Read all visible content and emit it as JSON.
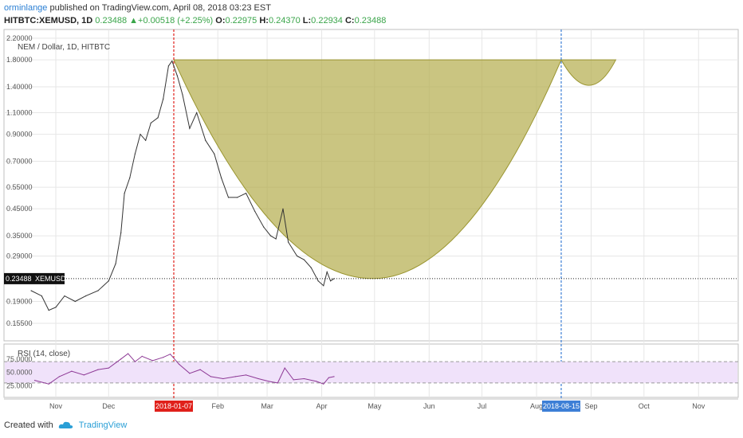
{
  "header": {
    "author": "orminlange",
    "published": "published on TradingView.com, April 08, 2018 03:23 EST",
    "symbol": "HITBTC:XEMUSD, 1D",
    "last": "0.23488",
    "change": "+0.00518 (+2.25%)",
    "o_label": "O:",
    "o": "0.22975",
    "h_label": "H:",
    "h": "0.24370",
    "l_label": "L:",
    "l": "0.22934",
    "c_label": "C:",
    "c": "0.23488"
  },
  "footer": {
    "created_with": "Created with",
    "brand": "TradingView"
  },
  "colors": {
    "price_line": "#333333",
    "cup_fill": "#b3ad4c",
    "cup_stroke": "#9a9530",
    "rsi_line": "#8e3a96",
    "rsi_band": "#f0e2fa",
    "red_marker": "#e0201a",
    "blue_marker": "#3d7fd6",
    "grid": "#e6e6e6"
  },
  "chart_data": [
    {
      "type": "line",
      "title": "NEM / Dollar, 1D, HITBTC",
      "series_name": "XEMUSD",
      "y_scale": "log",
      "y_ticks": [
        "2.20000",
        "1.80000",
        "1.40000",
        "1.10000",
        "0.90000",
        "0.70000",
        "0.55000",
        "0.45000",
        "0.35000",
        "0.29000",
        "0.19000",
        "0.15500"
      ],
      "x_ticks": [
        "Nov",
        "Dec",
        "Feb",
        "Mar",
        "Apr",
        "May",
        "Jun",
        "Jul",
        "Aug",
        "Sep",
        "Oct",
        "Nov"
      ],
      "x_date_markers": [
        "2018-01-07",
        "2018-08-15"
      ],
      "last_value": "0.23488",
      "last_label": "XEMUSD",
      "cup_points": [
        {
          "date": "2018-01-07",
          "value": 1.8
        },
        {
          "date": "2018-02-07",
          "value": 0.78
        },
        {
          "date": "2018-03-07",
          "value": 0.36
        },
        {
          "date": "2018-04-07",
          "value": 0.24
        },
        {
          "date": "2018-04-30",
          "value": 0.235
        },
        {
          "date": "2018-05-31",
          "value": 0.31
        },
        {
          "date": "2018-06-30",
          "value": 0.52
        },
        {
          "date": "2018-07-31",
          "value": 1.1
        },
        {
          "date": "2018-08-15",
          "value": 1.8
        }
      ],
      "handle_points": [
        {
          "date": "2018-08-15",
          "value": 1.8
        },
        {
          "date": "2018-08-31",
          "value": 1.42
        },
        {
          "date": "2018-09-15",
          "value": 1.8
        }
      ],
      "price_points": [
        {
          "date": "2017-10-18",
          "value": 0.21
        },
        {
          "date": "2017-10-24",
          "value": 0.2
        },
        {
          "date": "2017-10-28",
          "value": 0.175
        },
        {
          "date": "2017-11-01",
          "value": 0.18
        },
        {
          "date": "2017-11-06",
          "value": 0.2
        },
        {
          "date": "2017-11-12",
          "value": 0.19
        },
        {
          "date": "2017-11-18",
          "value": 0.2
        },
        {
          "date": "2017-11-25",
          "value": 0.21
        },
        {
          "date": "2017-12-01",
          "value": 0.23
        },
        {
          "date": "2017-12-05",
          "value": 0.27
        },
        {
          "date": "2017-12-08",
          "value": 0.36
        },
        {
          "date": "2017-12-10",
          "value": 0.52
        },
        {
          "date": "2017-12-13",
          "value": 0.6
        },
        {
          "date": "2017-12-16",
          "value": 0.75
        },
        {
          "date": "2017-12-19",
          "value": 0.9
        },
        {
          "date": "2017-12-22",
          "value": 0.85
        },
        {
          "date": "2017-12-25",
          "value": 1.0
        },
        {
          "date": "2017-12-29",
          "value": 1.05
        },
        {
          "date": "2018-01-01",
          "value": 1.25
        },
        {
          "date": "2018-01-04",
          "value": 1.7
        },
        {
          "date": "2018-01-06",
          "value": 1.78
        },
        {
          "date": "2018-01-09",
          "value": 1.55
        },
        {
          "date": "2018-01-12",
          "value": 1.3
        },
        {
          "date": "2018-01-16",
          "value": 0.95
        },
        {
          "date": "2018-01-20",
          "value": 1.1
        },
        {
          "date": "2018-01-25",
          "value": 0.85
        },
        {
          "date": "2018-01-30",
          "value": 0.75
        },
        {
          "date": "2018-02-03",
          "value": 0.6
        },
        {
          "date": "2018-02-07",
          "value": 0.5
        },
        {
          "date": "2018-02-12",
          "value": 0.5
        },
        {
          "date": "2018-02-17",
          "value": 0.52
        },
        {
          "date": "2018-02-22",
          "value": 0.44
        },
        {
          "date": "2018-02-27",
          "value": 0.38
        },
        {
          "date": "2018-03-03",
          "value": 0.35
        },
        {
          "date": "2018-03-06",
          "value": 0.34
        },
        {
          "date": "2018-03-10",
          "value": 0.45
        },
        {
          "date": "2018-03-13",
          "value": 0.33
        },
        {
          "date": "2018-03-18",
          "value": 0.29
        },
        {
          "date": "2018-03-22",
          "value": 0.28
        },
        {
          "date": "2018-03-26",
          "value": 0.26
        },
        {
          "date": "2018-03-30",
          "value": 0.23
        },
        {
          "date": "2018-04-02",
          "value": 0.22
        },
        {
          "date": "2018-04-04",
          "value": 0.25
        },
        {
          "date": "2018-04-06",
          "value": 0.23
        },
        {
          "date": "2018-04-08",
          "value": 0.23488
        }
      ]
    },
    {
      "type": "line",
      "title": "RSI (14, close)",
      "y_ticks": [
        "75.0000",
        "50.0000",
        "25.0000"
      ],
      "band": [
        30,
        70
      ],
      "rsi_points": [
        {
          "date": "2017-10-20",
          "value": 35
        },
        {
          "date": "2017-10-28",
          "value": 28
        },
        {
          "date": "2017-11-03",
          "value": 42
        },
        {
          "date": "2017-11-10",
          "value": 52
        },
        {
          "date": "2017-11-17",
          "value": 45
        },
        {
          "date": "2017-11-25",
          "value": 55
        },
        {
          "date": "2017-12-01",
          "value": 58
        },
        {
          "date": "2017-12-08",
          "value": 75
        },
        {
          "date": "2017-12-12",
          "value": 85
        },
        {
          "date": "2017-12-16",
          "value": 70
        },
        {
          "date": "2017-12-20",
          "value": 80
        },
        {
          "date": "2017-12-26",
          "value": 72
        },
        {
          "date": "2018-01-01",
          "value": 78
        },
        {
          "date": "2018-01-05",
          "value": 84
        },
        {
          "date": "2018-01-10",
          "value": 65
        },
        {
          "date": "2018-01-16",
          "value": 48
        },
        {
          "date": "2018-01-22",
          "value": 55
        },
        {
          "date": "2018-01-28",
          "value": 42
        },
        {
          "date": "2018-02-04",
          "value": 38
        },
        {
          "date": "2018-02-11",
          "value": 42
        },
        {
          "date": "2018-02-17",
          "value": 45
        },
        {
          "date": "2018-02-24",
          "value": 38
        },
        {
          "date": "2018-03-02",
          "value": 33
        },
        {
          "date": "2018-03-07",
          "value": 30
        },
        {
          "date": "2018-03-11",
          "value": 58
        },
        {
          "date": "2018-03-16",
          "value": 36
        },
        {
          "date": "2018-03-22",
          "value": 38
        },
        {
          "date": "2018-03-29",
          "value": 33
        },
        {
          "date": "2018-04-02",
          "value": 28
        },
        {
          "date": "2018-04-05",
          "value": 40
        },
        {
          "date": "2018-04-08",
          "value": 42
        }
      ]
    }
  ]
}
